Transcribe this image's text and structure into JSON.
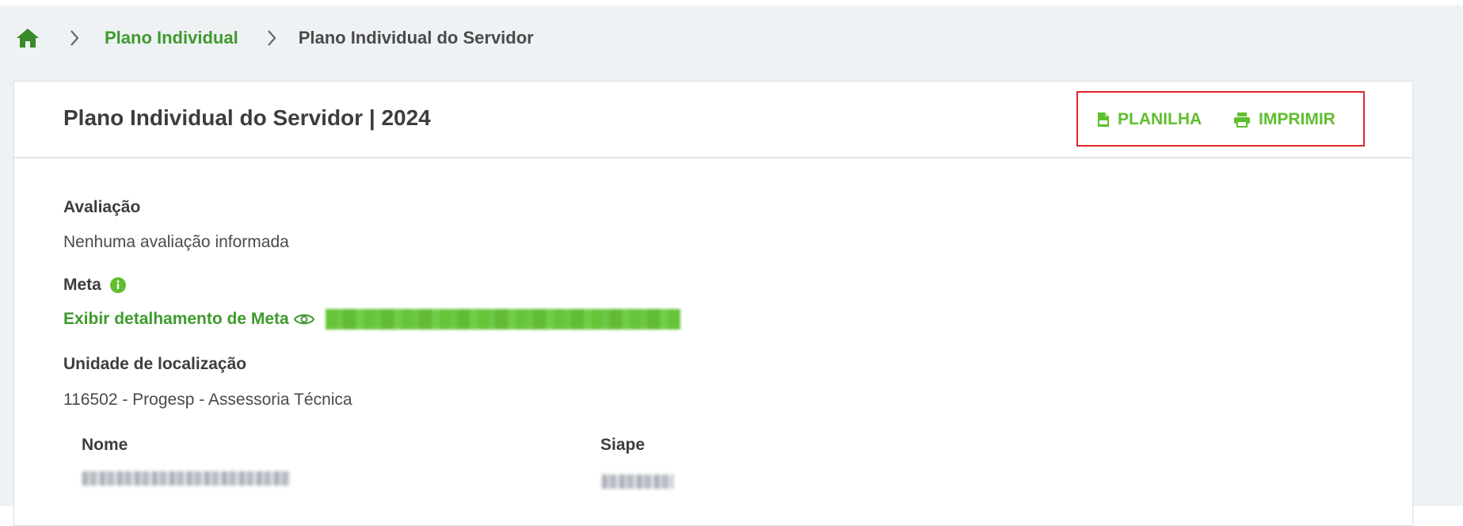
{
  "breadcrumb": {
    "home_icon": "home-icon",
    "items": [
      "Plano Individual",
      "Plano Individual do Servidor"
    ]
  },
  "card": {
    "title": "Plano Individual do Servidor | 2024",
    "actions": {
      "planilha_label": "PLANILHA",
      "planilha_icon": "csv-file-icon",
      "imprimir_label": "IMPRIMIR",
      "imprimir_icon": "printer-icon",
      "highlight_color": "#e1252a"
    }
  },
  "fields": {
    "avaliacao_label": "Avaliação",
    "avaliacao_value": "Nenhuma avaliação informada",
    "meta_label": "Meta",
    "meta_info_icon": "info-icon",
    "meta_link": "Exibir detalhamento de Meta",
    "meta_link_icon": "eye-icon",
    "unidade_label": "Unidade de localização",
    "unidade_value": "116502 - Progesp - Assessoria Técnica"
  },
  "table": {
    "columns": [
      "Nome",
      "Siape"
    ]
  },
  "colors": {
    "accent_green": "#3f9a2d",
    "action_green": "#5fbf2f",
    "background": "#eef2f5"
  }
}
